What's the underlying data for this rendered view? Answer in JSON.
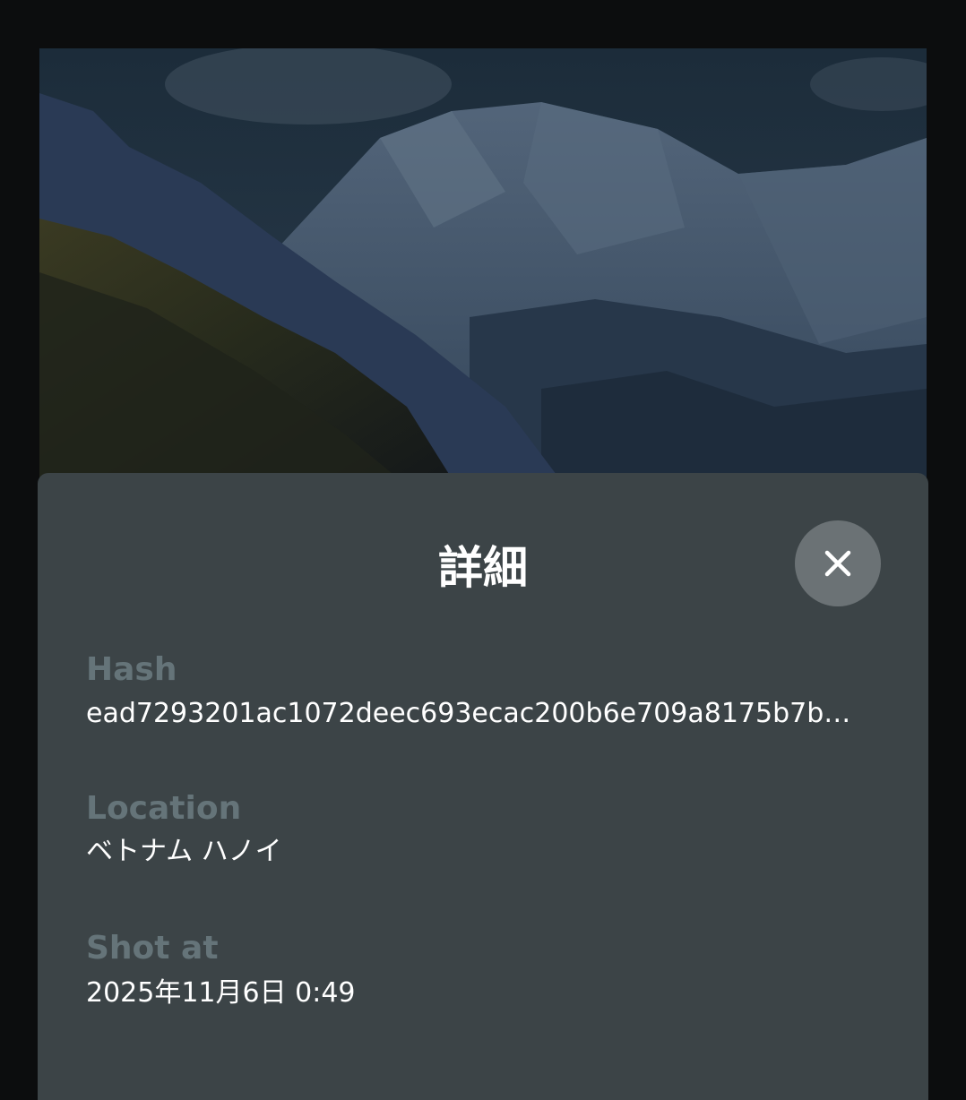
{
  "photo": {
    "description_icon": "mountain-landscape"
  },
  "details_sheet": {
    "title": "詳細",
    "close_icon": "close-icon",
    "fields": [
      {
        "label": "Hash",
        "value": "ead7293201ac1072deec693ecac200b6e709a8175b7b…"
      },
      {
        "label": "Location",
        "value": "ベトナム ハノイ"
      },
      {
        "label": "Shot at",
        "value": "2025年11月6日 0:49"
      }
    ]
  },
  "colors": {
    "page_background": "#0c0d0e",
    "sheet_background": "#3c4447",
    "label_color": "#657479",
    "value_color": "#ffffff",
    "close_button_background": "#6b7275"
  }
}
